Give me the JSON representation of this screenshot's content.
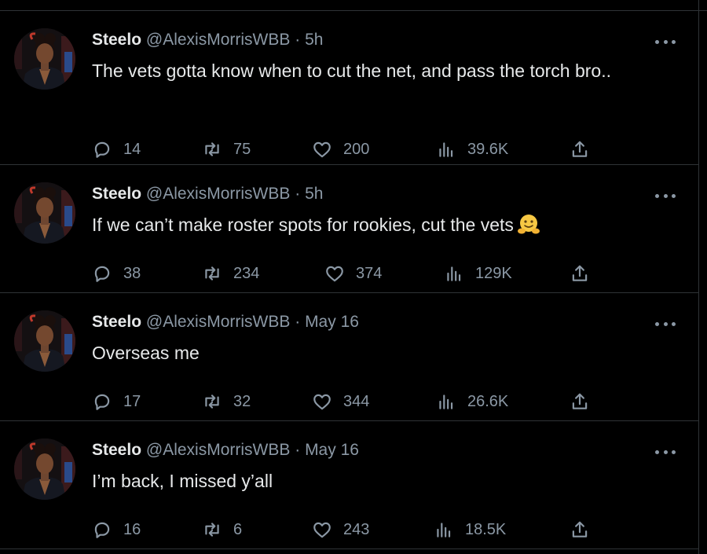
{
  "tweets": [
    {
      "name": "Steelo",
      "handle": "@AlexisMorrisWBB",
      "time": "5h",
      "text": "The vets gotta know when to cut the net, and pass the torch bro..",
      "emoji": "",
      "replies": "14",
      "reposts": "75",
      "likes": "200",
      "views": "39.6K"
    },
    {
      "name": "Steelo",
      "handle": "@AlexisMorrisWBB",
      "time": "5h",
      "text": "If we can’t make roster spots for rookies, cut the vets",
      "emoji": "hugging-face-emoji",
      "replies": "38",
      "reposts": "234",
      "likes": "374",
      "views": "129K"
    },
    {
      "name": "Steelo",
      "handle": "@AlexisMorrisWBB",
      "time": "May 16",
      "text": "Overseas me",
      "emoji": "",
      "replies": "17",
      "reposts": "32",
      "likes": "344",
      "views": "26.6K"
    },
    {
      "name": "Steelo",
      "handle": "@AlexisMorrisWBB",
      "time": "May 16",
      "text": "I’m back, I missed y’all",
      "emoji": "",
      "replies": "16",
      "reposts": "6",
      "likes": "243",
      "views": "18.5K"
    }
  ],
  "separator": "·",
  "icons": {
    "reply": "reply-icon",
    "repost": "repost-icon",
    "like": "heart-icon",
    "views": "views-icon",
    "share": "share-icon",
    "more": "more-icon"
  },
  "colors": {
    "background": "#000000",
    "primary_text": "#e7e9ea",
    "secondary_text": "#8b98a5",
    "divider": "#2f3336"
  }
}
